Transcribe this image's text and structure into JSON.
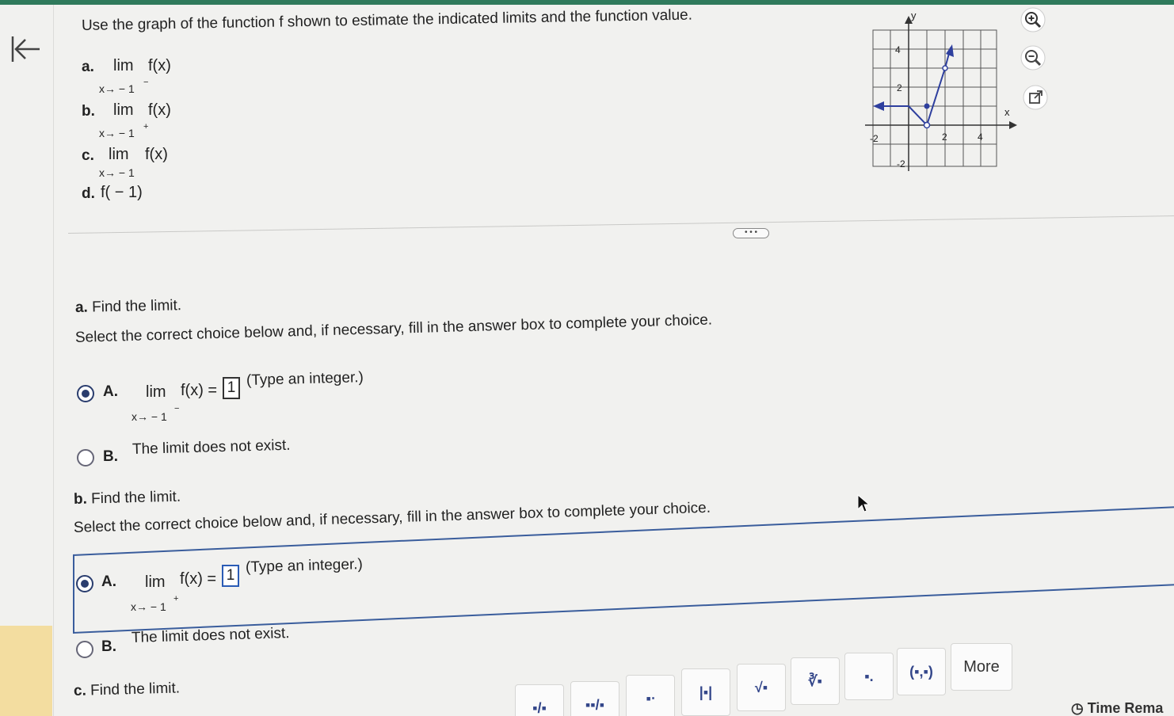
{
  "question": {
    "prompt": "Use the graph of the function f shown to estimate the indicated limits and the function value.",
    "parts": [
      {
        "letter": "a.",
        "lim": "lim",
        "func": "f(x)",
        "sub": "x→ − 1",
        "sup": "−"
      },
      {
        "letter": "b.",
        "lim": "lim",
        "func": "f(x)",
        "sub": "x→ − 1",
        "sup": "+"
      },
      {
        "letter": "c.",
        "lim": "lim",
        "func": "f(x)",
        "sub": "x→ − 1",
        "sup": ""
      },
      {
        "letter": "d.",
        "text": "f( − 1)"
      }
    ]
  },
  "graph": {
    "x_label": "x",
    "y_label": "y",
    "x_ticks": [
      "-2",
      "2",
      "4"
    ],
    "y_ticks": [
      "4",
      "2",
      "-2"
    ],
    "line_color": "#2e3f9e"
  },
  "divider": {
    "handle_label": "• • •"
  },
  "sections": [
    {
      "heading_letter": "a.",
      "heading": "Find the limit.",
      "instruction": "Select the correct choice below and, if necessary, fill in the answer box to complete your choice.",
      "choice_a": {
        "letter": "A.",
        "lim": "lim",
        "func": "f(x) =",
        "sub": "x→ − 1",
        "sup": "−",
        "answer": "1",
        "hint": "(Type an integer.)",
        "selected": true
      },
      "choice_b": {
        "letter": "B.",
        "text": "The limit does not exist.",
        "selected": false
      }
    },
    {
      "heading_letter": "b.",
      "heading": "Find the limit.",
      "instruction": "Select the correct choice below and, if necessary, fill in the answer box to complete your choice.",
      "choice_a": {
        "letter": "A.",
        "lim": "lim",
        "func": "f(x) =",
        "sub": "x→ − 1",
        "sup": "+",
        "answer": "1",
        "hint": "(Type an integer.)",
        "selected": true
      },
      "choice_b": {
        "letter": "B.",
        "text": "The limit does not exist.",
        "selected": false
      }
    },
    {
      "heading_letter": "c.",
      "heading": "Find the limit."
    }
  ],
  "toolbar": {
    "buttons": [
      "▪/▪",
      "▪▪/▪",
      "▪ᐧ",
      "|▪|",
      "√▪",
      "∛▪",
      "▪.",
      "(▪,▪)"
    ],
    "more_label": "More"
  },
  "time_label": "Time Rema",
  "accent_color": "#2a3d6e"
}
